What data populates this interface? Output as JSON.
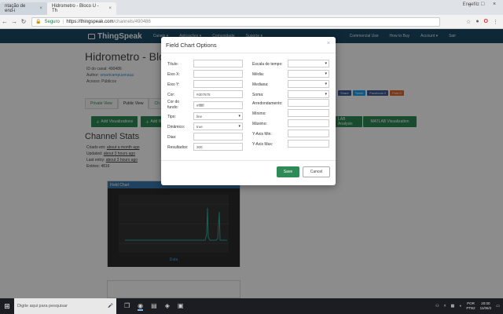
{
  "browser": {
    "tabs": [
      {
        "label": "ntação de end-i"
      },
      {
        "label": "Hidrometro - Bloco U - Th"
      }
    ],
    "user": "Engefilz",
    "secure_label": "Seguro",
    "url_host": "https://thingspeak.com",
    "url_path": "/channels/490486"
  },
  "thingspeak": {
    "logo": "ThingSpeak",
    "menu": [
      "Canais ▾",
      "Aplicações ▾",
      "Comunidade",
      "Suporte ▾"
    ],
    "right_menu": [
      "Commercial Use",
      "How to Buy",
      "Account ▾",
      "Sair"
    ],
    "share": [
      "Share",
      "Tweet",
      "Facebook 0",
      "Fork 0"
    ]
  },
  "channel": {
    "title": "Hidrometro - Blo",
    "id_line": "ID do canal: 490486",
    "author_label": "Author:",
    "author": "smartcampusmaua",
    "access": "Acesso: Públicos",
    "tabs": [
      "Private View",
      "Public View",
      "Ch"
    ],
    "add_visualizations": "Add Visualizations",
    "add_widgets": "Add W",
    "matlab_analysis": "LAB Analysis",
    "matlab_visualization": "MATLAB Visualization",
    "stats_title": "Channel Stats",
    "created_label": "Criado em:",
    "created": "about a month ago",
    "updated_label": "Updated:",
    "updated": "about 3 hours ago",
    "last_entry_label": "Last entry:",
    "last_entry": "about 3 hours ago",
    "entries": "Entries: 4816",
    "chart_title": "Field Chart",
    "chart_xlabel": "Data"
  },
  "modal": {
    "title": "Field Chart Options",
    "close": "×",
    "left_fields": [
      {
        "label": "Título:",
        "value": "",
        "type": "text"
      },
      {
        "label": "Eixo X:",
        "value": "",
        "type": "text"
      },
      {
        "label": "Eixo Y:",
        "value": "",
        "type": "text"
      },
      {
        "label": "Cor:",
        "value": "#d07878",
        "type": "text"
      },
      {
        "label": "Cor do fundo:",
        "value": "#ffffff",
        "type": "text"
      },
      {
        "label": "Tipo:",
        "value": "line",
        "type": "select"
      },
      {
        "label": "Dinâmico:",
        "value": "true",
        "type": "select"
      },
      {
        "label": "Dias:",
        "value": "",
        "type": "text"
      },
      {
        "label": "Resultados:",
        "value": "300",
        "type": "text"
      }
    ],
    "right_fields": [
      {
        "label": "Escala de tempo:",
        "value": "",
        "type": "select"
      },
      {
        "label": "Média:",
        "value": "",
        "type": "select"
      },
      {
        "label": "Mediana:",
        "value": "",
        "type": "select"
      },
      {
        "label": "Soma:",
        "value": "",
        "type": "select"
      },
      {
        "label": "Arredondamento:",
        "value": "",
        "type": "text"
      },
      {
        "label": "Mínimo:",
        "value": "",
        "type": "text"
      },
      {
        "label": "Máximo:",
        "value": "",
        "type": "text"
      },
      {
        "label": "Y-Axis Min:",
        "value": "",
        "type": "text"
      },
      {
        "label": "Y-Axis Max:",
        "value": "",
        "type": "text"
      }
    ],
    "save": "Save",
    "cancel": "Cancel"
  },
  "taskbar": {
    "search_placeholder": "Digite aqui para pesquisar",
    "lang": "POR",
    "lang2": "PTB2",
    "time": "20:00",
    "date": "11/06/2"
  }
}
